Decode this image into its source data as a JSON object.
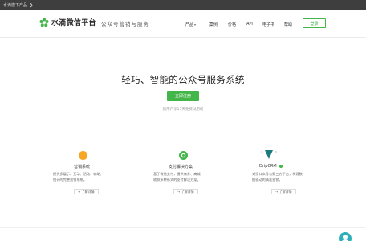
{
  "topbar": {
    "text": "水滴旗下产品",
    "arrow": "❯"
  },
  "header": {
    "logo_text": "水滴微信平台",
    "slogan": "公众号营销与服务",
    "nav": [
      {
        "label": "产品",
        "has_caret": true
      },
      {
        "label": "案例"
      },
      {
        "label": "价格"
      },
      {
        "label": "API"
      },
      {
        "label": "电子书"
      },
      {
        "label": "帮助"
      }
    ],
    "login_label": "登录"
  },
  "hero": {
    "title": "轻巧、智能的公众号服务系统",
    "register_label": "立即注册",
    "subtitle": "新用户享15天免费试用权"
  },
  "features": [
    {
      "title": "营销系统",
      "desc": [
        "提供多展示、互动、活动、辅助、",
        "统计的完整营销系统。"
      ],
      "more": "→ 了解详情",
      "icon_color": "#f5a623"
    },
    {
      "title": "支付解决方案",
      "desc": [
        "基于微信支付，提供商券、商城、",
        "收款多种形式的支付解决方案。"
      ],
      "more": "→ 了解详情",
      "icon_color": "#44b549"
    },
    {
      "title": "DripCRM",
      "desc": [
        "对接公众号与第三方平台，构建数",
        "据驱动的精准营销。"
      ],
      "more": "→ 了解详情",
      "icon_color": "#1d7a7c"
    }
  ],
  "colors": {
    "brand_green": "#44b549",
    "topbar_bg": "#3e3e3e",
    "float_button": "#2db0b9"
  }
}
